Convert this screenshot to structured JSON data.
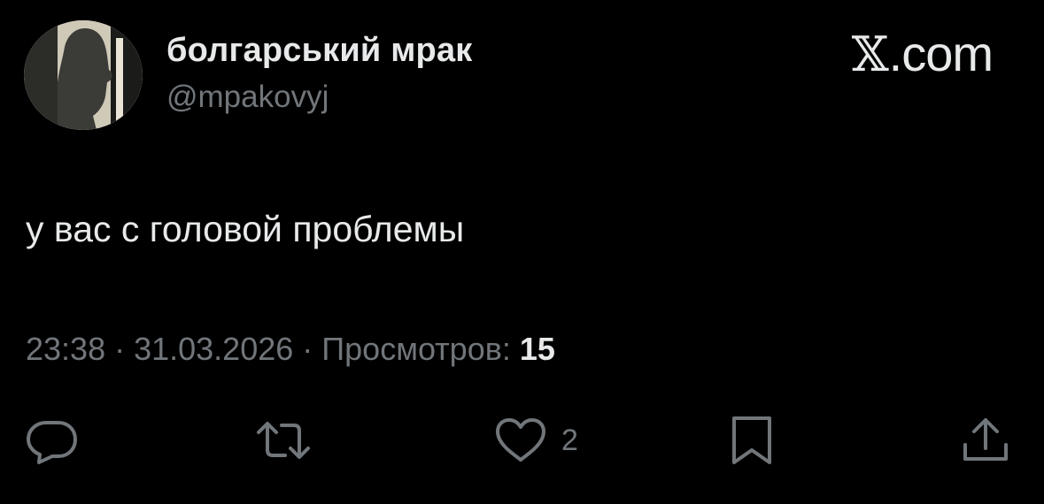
{
  "author": {
    "display_name": "болгарський мрак",
    "handle": "@mpakovyj"
  },
  "brand": {
    "mark": "𝕏",
    "suffix": ".com"
  },
  "tweet": {
    "text": "у вас с головой проблемы"
  },
  "meta": {
    "time": "23:38",
    "separator_1": " · ",
    "date": "31.03.2026",
    "separator_2": " · ",
    "views_label": "Просмотров: ",
    "views_count": "15"
  },
  "actions": {
    "reply": {
      "icon": "reply-icon"
    },
    "retweet": {
      "icon": "retweet-icon"
    },
    "like": {
      "icon": "heart-icon",
      "count": "2"
    },
    "bookmark": {
      "icon": "bookmark-icon"
    },
    "share": {
      "icon": "share-icon"
    }
  },
  "colors": {
    "background": "#000000",
    "primary_text": "#e7e9ea",
    "secondary_text": "#71767b"
  }
}
